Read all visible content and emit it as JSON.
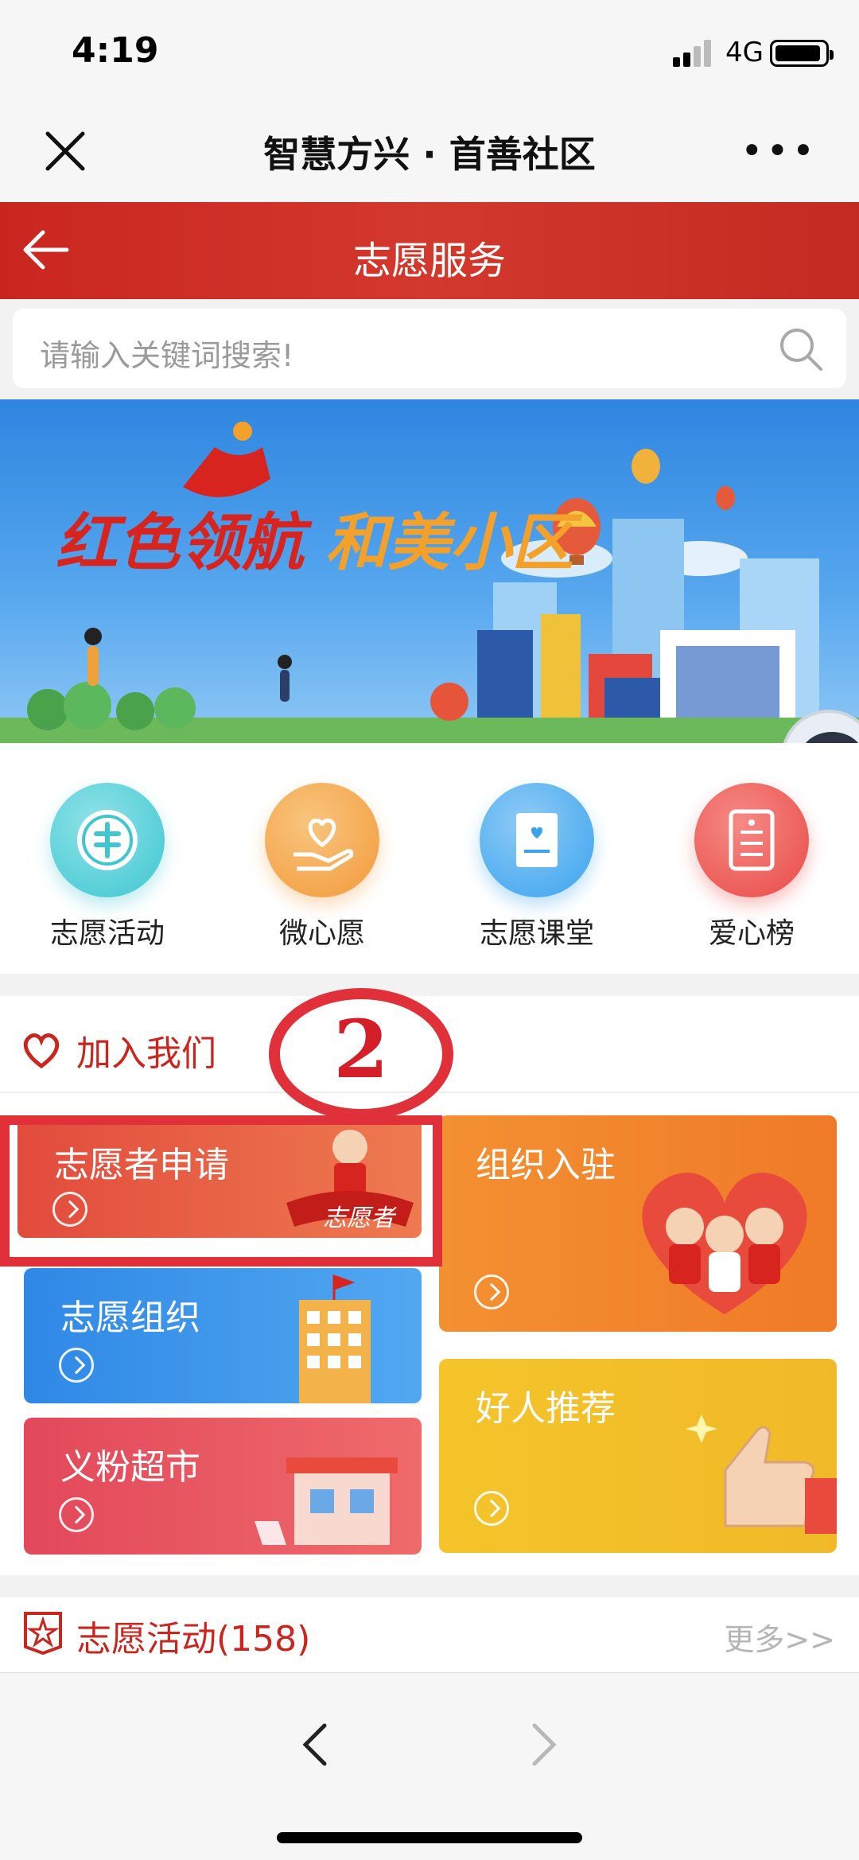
{
  "status_bar": {
    "time": "4:19",
    "network": "4G",
    "battery_icon": "battery-icon",
    "signal_icon": "signal-icon"
  },
  "wechat_bar": {
    "title": "智慧方兴 · 首善社区",
    "close_icon": "close-icon",
    "more_icon": "more-icon",
    "more_text": "•••"
  },
  "page_header": {
    "title": "志愿服务",
    "back_icon": "back-arrow-icon"
  },
  "search": {
    "placeholder": "请输入关键词搜索!",
    "icon": "search-icon"
  },
  "banner": {
    "slogan_red": "红色领航",
    "slogan_orange": "和美小区"
  },
  "quick_menu": [
    {
      "label": "志愿活动",
      "icon": "volunteer-badge-icon",
      "color": "#3fc6d0"
    },
    {
      "label": "微心愿",
      "icon": "heart-hand-icon",
      "color": "#f39a3a"
    },
    {
      "label": "志愿课堂",
      "icon": "book-icon",
      "color": "#3aa3ee"
    },
    {
      "label": "爱心榜",
      "icon": "list-icon",
      "color": "#ea4a45"
    }
  ],
  "join_section": {
    "title": "加入我们",
    "icon": "heart-outline-icon",
    "cards": [
      {
        "label": "志愿者申请",
        "badge": "志愿者"
      },
      {
        "label": "组织入驻"
      },
      {
        "label": "志愿组织"
      },
      {
        "label": "好人推荐"
      },
      {
        "label": "义粉超市"
      }
    ]
  },
  "annotation": {
    "number": "2"
  },
  "activity_section": {
    "title": "志愿活动(158)",
    "more": "更多>>",
    "icon": "star-badge-icon"
  },
  "bottom_nav": {
    "prev_icon": "chevron-left-icon",
    "next_icon": "chevron-right-icon"
  }
}
